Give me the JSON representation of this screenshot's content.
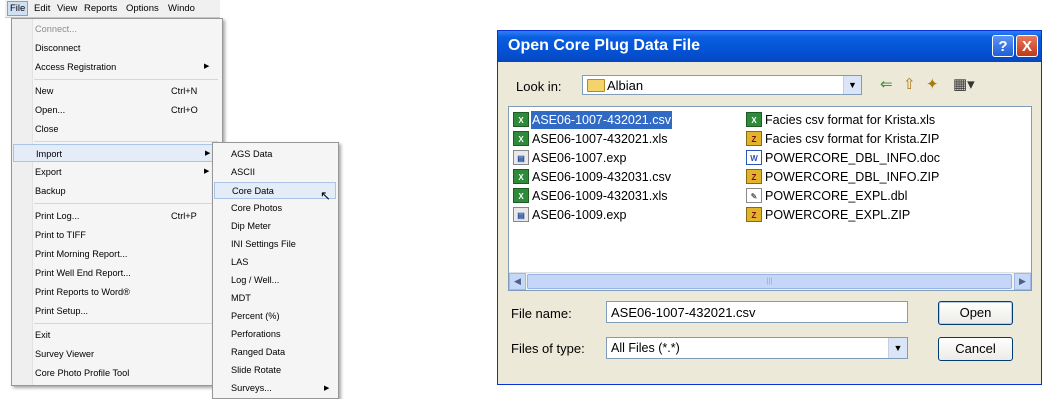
{
  "menubar": {
    "items": [
      "File",
      "Edit",
      "View",
      "Reports",
      "Options",
      "Windo"
    ],
    "active": "File"
  },
  "file_menu": {
    "items": [
      {
        "label": "Connect...",
        "disabled": true
      },
      {
        "label": "Disconnect"
      },
      {
        "label": "Access Registration",
        "submenu": true
      },
      {
        "label": "New",
        "shortcut": "Ctrl+N"
      },
      {
        "label": "Open...",
        "shortcut": "Ctrl+O"
      },
      {
        "label": "Close"
      },
      {
        "label": "Import",
        "submenu": true,
        "highlighted": true
      },
      {
        "label": "Export",
        "submenu": true
      },
      {
        "label": "Backup"
      },
      {
        "label": "Print Log...",
        "shortcut": "Ctrl+P"
      },
      {
        "label": "Print to TIFF"
      },
      {
        "label": "Print Morning Report..."
      },
      {
        "label": "Print Well End Report..."
      },
      {
        "label": "Print Reports to Word®"
      },
      {
        "label": "Print Setup..."
      },
      {
        "label": "Exit"
      },
      {
        "label": "Survey Viewer"
      },
      {
        "label": "Core Photo Profile Tool"
      }
    ]
  },
  "import_submenu": {
    "items": [
      {
        "label": "AGS Data"
      },
      {
        "label": "ASCII"
      },
      {
        "label": "Core Data",
        "highlighted": true
      },
      {
        "label": "Core Photos"
      },
      {
        "label": "Dip Meter"
      },
      {
        "label": "INI Settings File"
      },
      {
        "label": "LAS"
      },
      {
        "label": "Log / Well..."
      },
      {
        "label": "MDT"
      },
      {
        "label": "Percent (%)"
      },
      {
        "label": "Perforations"
      },
      {
        "label": "Ranged Data"
      },
      {
        "label": "Slide Rotate"
      },
      {
        "label": "Surveys...",
        "submenu": true
      }
    ]
  },
  "dialog": {
    "title": "Open Core Plug Data File",
    "help_glyph": "?",
    "close_glyph": "X",
    "look_in_label": "Look in:",
    "look_in_value": "Albian",
    "files": [
      {
        "name": "ASE06-1007-432021.csv",
        "type": "csv",
        "selected": true
      },
      {
        "name": "ASE06-1007-432021.xls",
        "type": "xls"
      },
      {
        "name": "ASE06-1007.exp",
        "type": "exp"
      },
      {
        "name": "ASE06-1009-432031.csv",
        "type": "csv"
      },
      {
        "name": "ASE06-1009-432031.xls",
        "type": "xls"
      },
      {
        "name": "ASE06-1009.exp",
        "type": "exp"
      },
      {
        "name": "Facies csv format for Krista.xls",
        "type": "xls"
      },
      {
        "name": "Facies csv format for Krista.ZIP",
        "type": "zip"
      },
      {
        "name": "POWERCORE_DBL_INFO.doc",
        "type": "doc"
      },
      {
        "name": "POWERCORE_DBL_INFO.ZIP",
        "type": "zip"
      },
      {
        "name": "POWERCORE_EXPL.dbl",
        "type": "dbl"
      },
      {
        "name": "POWERCORE_EXPL.ZIP",
        "type": "zip"
      }
    ],
    "file_name_label": "File name:",
    "file_name_value": "ASE06-1007-432021.csv",
    "files_of_type_label": "Files of type:",
    "files_of_type_value": "All Files (*.*)",
    "open_label": "Open",
    "cancel_label": "Cancel"
  }
}
